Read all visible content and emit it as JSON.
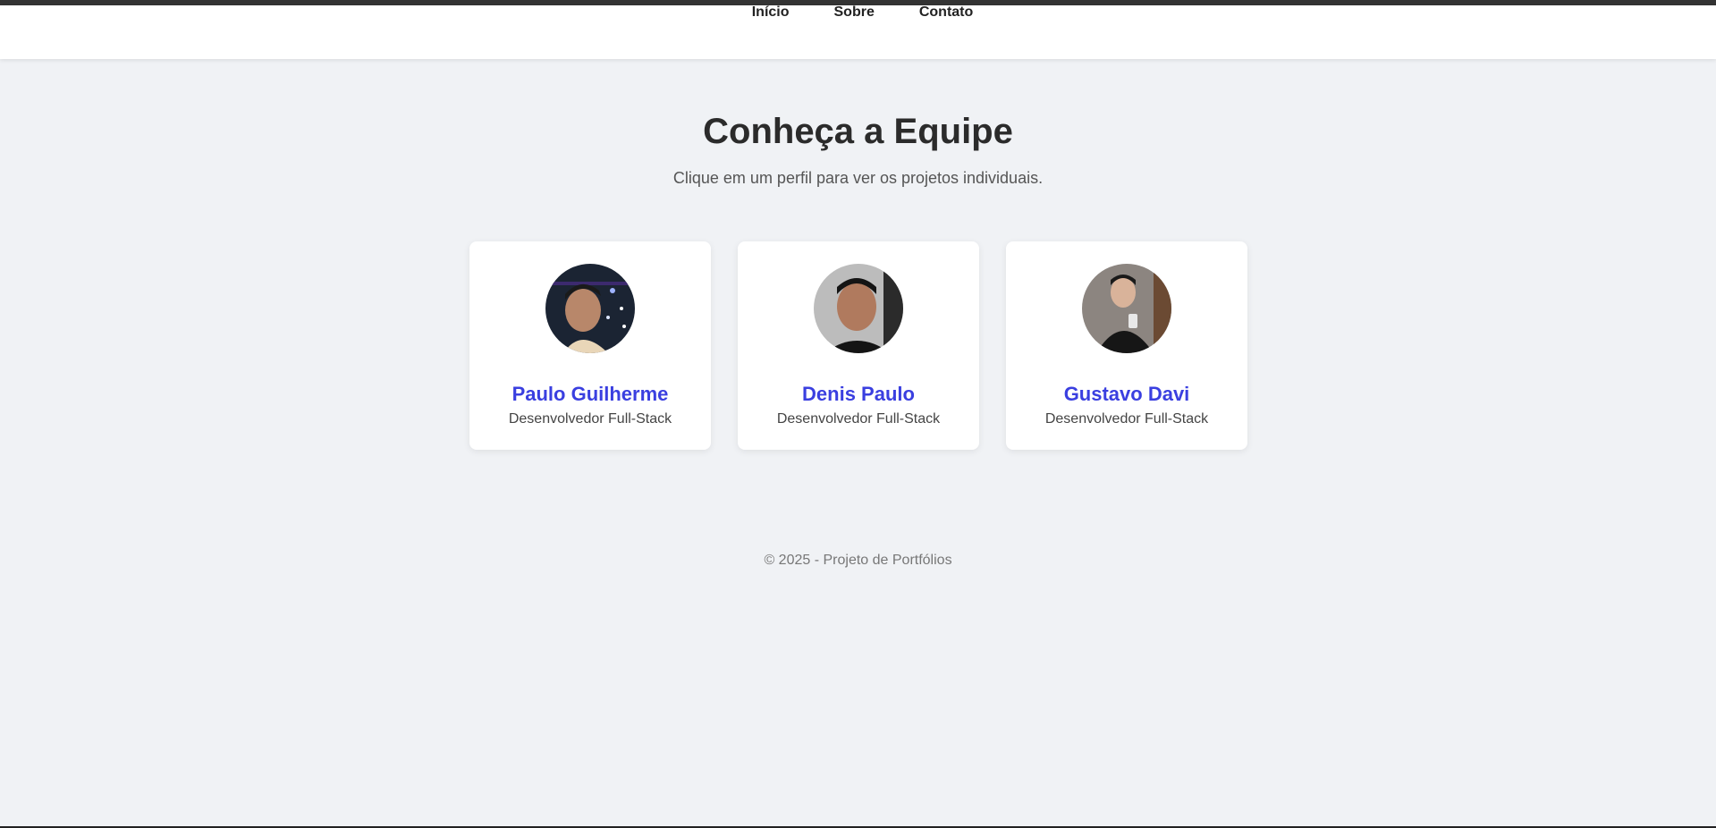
{
  "nav": {
    "links": [
      {
        "label": "Início"
      },
      {
        "label": "Sobre"
      },
      {
        "label": "Contato"
      }
    ]
  },
  "hero": {
    "title": "Conheça a Equipe",
    "subtitle": "Clique em um perfil para ver os projetos individuais."
  },
  "team": [
    {
      "name": "Paulo Guilherme",
      "role": "Desenvolvedor Full-Stack"
    },
    {
      "name": "Denis Paulo",
      "role": "Desenvolvedor Full-Stack"
    },
    {
      "name": "Gustavo Davi",
      "role": "Desenvolvedor Full-Stack"
    }
  ],
  "footer": {
    "text": "© 2025 - Projeto de Portfólios"
  },
  "colors": {
    "accent": "#3a3fe0",
    "background": "#f0f2f5"
  }
}
